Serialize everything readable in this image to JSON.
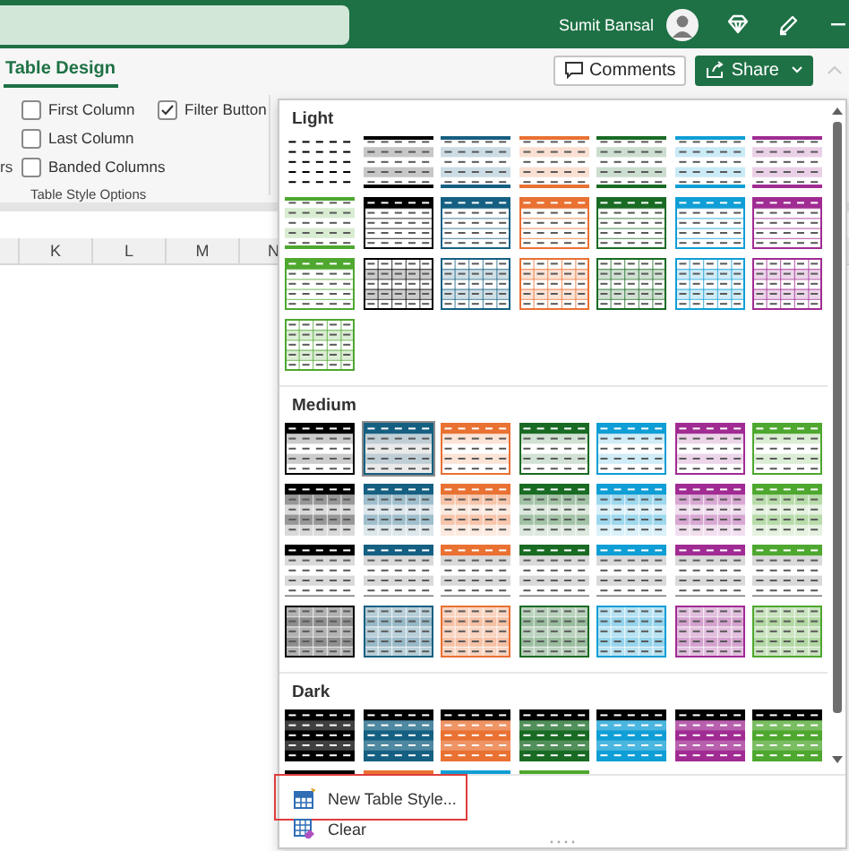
{
  "title_bar": {
    "user_name": "Sumit Bansal"
  },
  "ribbon": {
    "tabs": [
      {
        "label": "Table Design",
        "selected": true
      }
    ],
    "buttons": [
      {
        "label": "Comments",
        "kind": "outline"
      },
      {
        "label": "Share",
        "kind": "primary"
      }
    ]
  },
  "style_options": {
    "cut_label": "rs",
    "checkboxes": [
      {
        "label": "First Column",
        "checked": false
      },
      {
        "label": "Last Column",
        "checked": false
      },
      {
        "label": "Banded Columns",
        "checked": false
      },
      {
        "label": "Filter Button",
        "checked": true
      }
    ],
    "group_label": "Table Style Options"
  },
  "sheet": {
    "column_headers": [
      "K",
      "L",
      "M",
      "N"
    ]
  },
  "style_gallery": {
    "sections": [
      {
        "title": "Light",
        "styles": [
          {
            "kind": "plain",
            "color": "#000000",
            "selected": false
          },
          {
            "kind": "banded",
            "color": "#000000",
            "selected": false
          },
          {
            "kind": "banded",
            "color": "#156082",
            "selected": false
          },
          {
            "kind": "banded",
            "color": "#e97132",
            "selected": false
          },
          {
            "kind": "banded",
            "color": "#196b24",
            "selected": false
          },
          {
            "kind": "banded",
            "color": "#0f9ed5",
            "selected": false
          },
          {
            "kind": "banded",
            "color": "#a02b93",
            "selected": false
          },
          {
            "kind": "banded",
            "color": "#4ea72e",
            "selected": false
          },
          {
            "kind": "header",
            "color": "#000000",
            "selected": false
          },
          {
            "kind": "header",
            "color": "#156082",
            "selected": false
          },
          {
            "kind": "header",
            "color": "#e97132",
            "selected": false
          },
          {
            "kind": "header",
            "color": "#196b24",
            "selected": false
          },
          {
            "kind": "header",
            "color": "#0f9ed5",
            "selected": false
          },
          {
            "kind": "header",
            "color": "#a02b93",
            "selected": false
          },
          {
            "kind": "header",
            "color": "#4ea72e",
            "selected": false
          },
          {
            "kind": "grid",
            "color": "#000000",
            "selected": false
          },
          {
            "kind": "grid",
            "color": "#156082",
            "selected": false
          },
          {
            "kind": "grid",
            "color": "#e97132",
            "selected": false
          },
          {
            "kind": "grid",
            "color": "#196b24",
            "selected": false
          },
          {
            "kind": "grid",
            "color": "#0f9ed5",
            "selected": false
          },
          {
            "kind": "grid",
            "color": "#a02b93",
            "selected": false
          },
          {
            "kind": "grid",
            "color": "#4ea72e",
            "selected": false
          }
        ]
      },
      {
        "title": "Medium",
        "styles": [
          {
            "kind": "header-banded",
            "color": "#000000",
            "selected": false
          },
          {
            "kind": "header-banded",
            "color": "#156082",
            "selected": true
          },
          {
            "kind": "header-banded",
            "color": "#e97132",
            "selected": false
          },
          {
            "kind": "header-banded",
            "color": "#196b24",
            "selected": false
          },
          {
            "kind": "header-banded",
            "color": "#0f9ed5",
            "selected": false
          },
          {
            "kind": "header-banded",
            "color": "#a02b93",
            "selected": false
          },
          {
            "kind": "header-banded",
            "color": "#4ea72e",
            "selected": false
          },
          {
            "kind": "header-fill",
            "color": "#000000",
            "selected": false
          },
          {
            "kind": "header-fill",
            "color": "#156082",
            "selected": false
          },
          {
            "kind": "header-fill",
            "color": "#e97132",
            "selected": false
          },
          {
            "kind": "header-fill",
            "color": "#196b24",
            "selected": false
          },
          {
            "kind": "header-fill",
            "color": "#0f9ed5",
            "selected": false
          },
          {
            "kind": "header-fill",
            "color": "#a02b93",
            "selected": false
          },
          {
            "kind": "header-fill",
            "color": "#4ea72e",
            "selected": false
          },
          {
            "kind": "header-gray",
            "color": "#000000",
            "selected": false
          },
          {
            "kind": "header-gray",
            "color": "#156082",
            "selected": false
          },
          {
            "kind": "header-gray",
            "color": "#e97132",
            "selected": false
          },
          {
            "kind": "header-gray",
            "color": "#196b24",
            "selected": false
          },
          {
            "kind": "header-gray",
            "color": "#0f9ed5",
            "selected": false
          },
          {
            "kind": "header-gray",
            "color": "#a02b93",
            "selected": false
          },
          {
            "kind": "header-gray",
            "color": "#4ea72e",
            "selected": false
          },
          {
            "kind": "fill-grid",
            "color": "#000000",
            "selected": false
          },
          {
            "kind": "fill-grid",
            "color": "#156082",
            "selected": false
          },
          {
            "kind": "fill-grid",
            "color": "#e97132",
            "selected": false
          },
          {
            "kind": "fill-grid",
            "color": "#196b24",
            "selected": false
          },
          {
            "kind": "fill-grid",
            "color": "#0f9ed5",
            "selected": false
          },
          {
            "kind": "fill-grid",
            "color": "#a02b93",
            "selected": false
          },
          {
            "kind": "fill-grid",
            "color": "#4ea72e",
            "selected": false
          }
        ]
      },
      {
        "title": "Dark",
        "styles": [
          {
            "kind": "dark",
            "color": "#000000",
            "selected": false
          },
          {
            "kind": "dark",
            "color": "#156082",
            "selected": false
          },
          {
            "kind": "dark",
            "color": "#e97132",
            "selected": false
          },
          {
            "kind": "dark",
            "color": "#196b24",
            "selected": false
          },
          {
            "kind": "dark",
            "color": "#0f9ed5",
            "selected": false
          },
          {
            "kind": "dark",
            "color": "#a02b93",
            "selected": false
          },
          {
            "kind": "dark",
            "color": "#4ea72e",
            "selected": false
          },
          {
            "kind": "cut",
            "color": "#000000",
            "selected": false
          },
          {
            "kind": "cut",
            "color": "#e97132",
            "selected": false
          },
          {
            "kind": "cut",
            "color": "#0f9ed5",
            "selected": false
          },
          {
            "kind": "cut",
            "color": "#4ea72e",
            "selected": false
          }
        ]
      }
    ],
    "commands": [
      {
        "kind": "new",
        "label": "New Table Style...",
        "highlighted": true
      },
      {
        "kind": "clear",
        "label": "Clear",
        "highlighted": false
      }
    ]
  }
}
